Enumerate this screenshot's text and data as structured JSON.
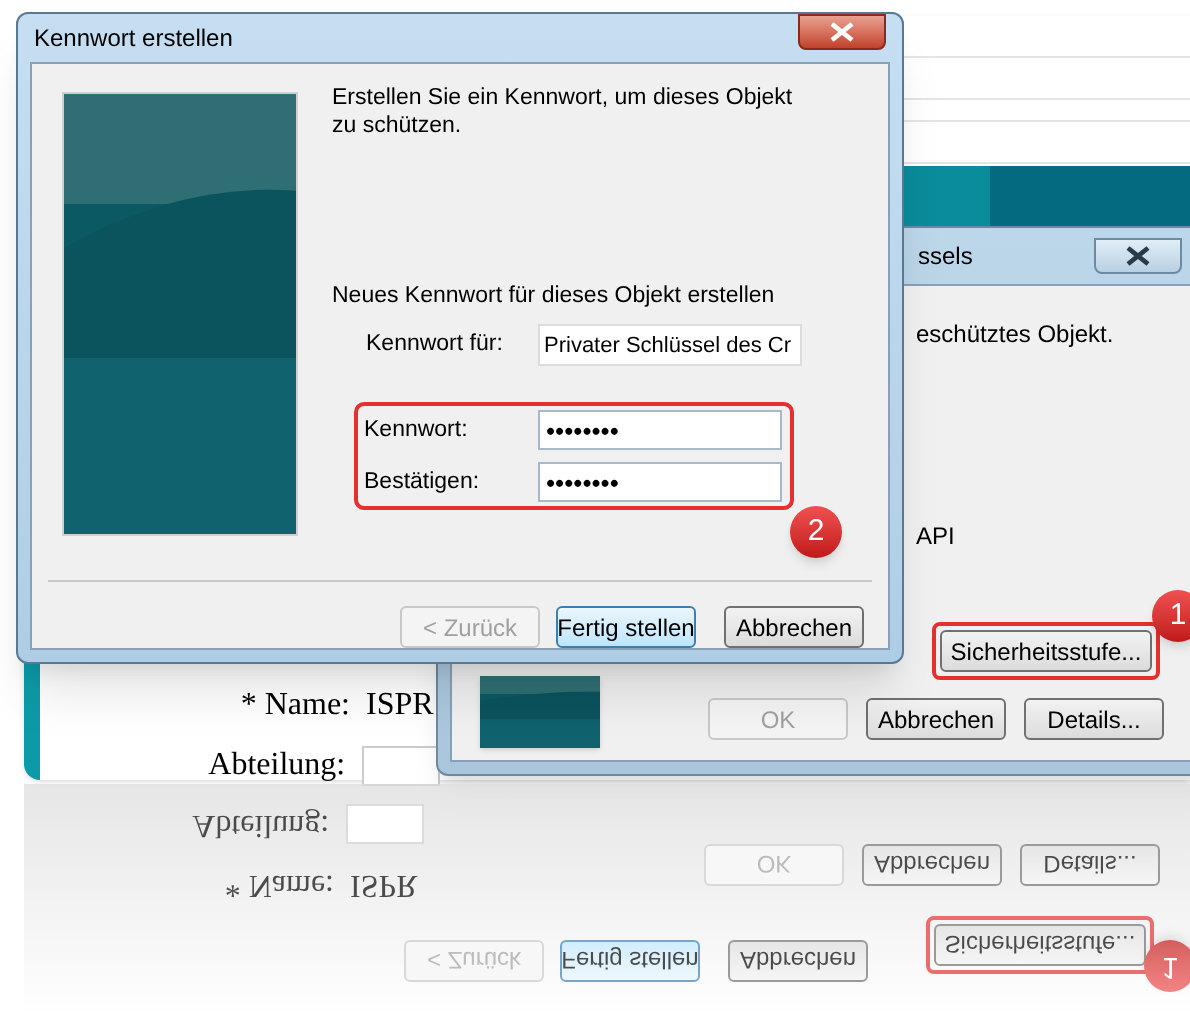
{
  "web_form": {
    "fields": [
      {
        "label": "* Name:",
        "value": "ISPR"
      },
      {
        "label": "Abteilung:"
      }
    ]
  },
  "security_dialog": {
    "title": "ssels",
    "text": "eschütztes Objekt.",
    "text_2": "API",
    "level_button": {
      "label": "Sicherheitsstufe...",
      "highlighted": true,
      "callout": "1"
    },
    "buttons": [
      {
        "label": "OK",
        "disabled": true
      },
      {
        "label": "Abbrechen",
        "disabled": false
      },
      {
        "label": "Details...",
        "disabled": false
      }
    ]
  },
  "password_dialog": {
    "title": "Kennwort erstellen",
    "intro": "Erstellen Sie ein Kennwort, um dieses Objekt zu schützen.",
    "section_label": "Neues Kennwort für dieses Objekt erstellen",
    "target": {
      "label": "Kennwort für:",
      "value": "Privater Schlüssel des Cr"
    },
    "fields": [
      {
        "label": "Kennwort:",
        "value": "••••••••"
      },
      {
        "label": "Bestätigen:",
        "value": "••••••••"
      }
    ],
    "fields_highlighted": true,
    "callout": "2",
    "buttons": [
      {
        "label": "< Zurück",
        "disabled": true,
        "default": false
      },
      {
        "label": "Fertig stellen",
        "disabled": false,
        "default": true
      },
      {
        "label": "Abbrechen",
        "disabled": false,
        "default": false
      }
    ]
  },
  "reflection": {
    "fields": [
      {
        "label": "Abteilung:"
      },
      {
        "label": "* Name:",
        "value": "ISPR"
      }
    ],
    "buttons": [
      {
        "label": "OK",
        "disabled": true
      },
      {
        "label": "Abbrechen",
        "disabled": false
      },
      {
        "label": "Details...",
        "disabled": false
      }
    ],
    "level_button": {
      "label": "Sicherheitsstufe...",
      "callout": "1"
    },
    "wizard_buttons": [
      {
        "label": "< Zurück",
        "disabled": true
      },
      {
        "label": "Fertig stellen",
        "disabled": false
      },
      {
        "label": "Abbrechen",
        "disabled": false
      }
    ]
  }
}
